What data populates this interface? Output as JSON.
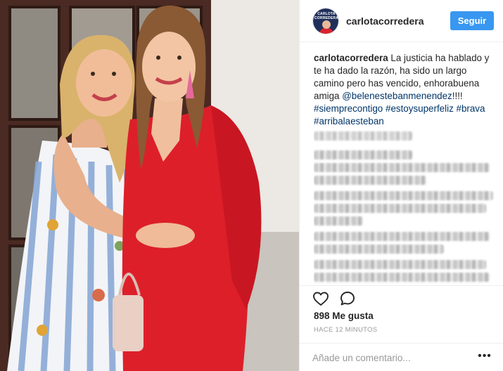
{
  "post": {
    "username": "carlotacorredera",
    "avatar_text": "CARLOTA CORREDERA",
    "follow_label": "Seguir",
    "caption": {
      "username": "carlotacorredera",
      "text": " La justicia ha hablado y te ha dado la razón, ha sido un largo camino pero has vencido, enhorabuena amiga ",
      "mention": "@belenestebanmenendez",
      "after_mention": "!!!! ",
      "hashtags": [
        "#siemprecontigo",
        "#estoysuperfeliz",
        "#brava",
        "#arribalaesteban"
      ]
    },
    "likes_label": "898 Me gusta",
    "timestamp": "HACE 12 MINUTOS",
    "comment_placeholder": "Añade un comentario...",
    "more_label": "•••"
  },
  "icons": {
    "like": "heart-outline-icon",
    "comment": "speech-bubble-icon",
    "more": "ellipsis-icon"
  },
  "colors": {
    "follow_button": "#3897f0",
    "link": "#003569",
    "muted": "#999999",
    "text": "#262626"
  }
}
